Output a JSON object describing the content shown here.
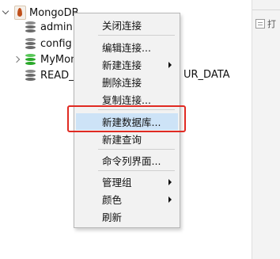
{
  "tree": {
    "connection": {
      "label": "MongoDB",
      "icon": "mongodb-leaf-icon",
      "expanded": true
    },
    "databases": [
      {
        "label": "admin",
        "icon": "database-icon",
        "color": "#6a6a6a"
      },
      {
        "label": "config",
        "icon": "database-icon",
        "color": "#6a6a6a"
      },
      {
        "label": "MyMongo",
        "icon": "database-icon",
        "color": "#2aa82a",
        "expandable": true
      },
      {
        "label": "READ_",
        "label_tail": "UR_DATA",
        "icon": "database-icon",
        "color": "#6a6a6a"
      }
    ]
  },
  "context_menu": {
    "items": [
      {
        "label": "关闭连接"
      },
      {
        "label": "编辑连接..."
      },
      {
        "label": "新建连接",
        "submenu": true
      },
      {
        "label": "删除连接"
      },
      {
        "label": "复制连接..."
      },
      {
        "label": "新建数据库...",
        "highlighted": true
      },
      {
        "label": "新建查询"
      },
      {
        "label": "命令列界面..."
      },
      {
        "label": "管理组",
        "submenu": true
      },
      {
        "label": "颜色",
        "submenu": true
      },
      {
        "label": "刷新"
      }
    ]
  },
  "right_panel": {
    "open_label": "打"
  },
  "annotation": {
    "highlight_color": "#e02a22"
  }
}
